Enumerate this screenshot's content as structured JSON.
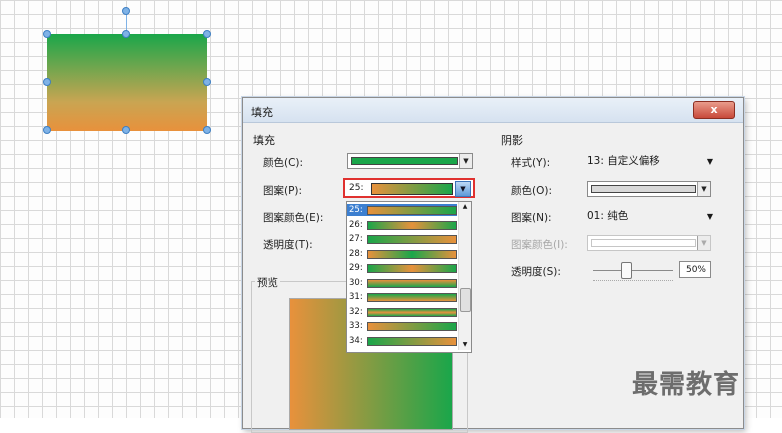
{
  "dialog": {
    "title": "填充",
    "close_label": "x",
    "fill": {
      "section": "填充",
      "color_label": "颜色(C):",
      "color_value": "#1aa64a",
      "pattern_label": "图案(P):",
      "pattern_value": "25:",
      "pattern_color_label": "图案颜色(E):",
      "transparency_label": "透明度(T):",
      "pattern_list": [
        {
          "n": "25:",
          "selected": true,
          "swatch": "linear-gradient(to right,#e8913c,#1aa64a)"
        },
        {
          "n": "26:",
          "selected": false,
          "swatch": "radial-gradient(circle,#e8913c,#1aa64a)"
        },
        {
          "n": "27:",
          "selected": false,
          "swatch": "linear-gradient(to right,#1aa64a,#e8913c)"
        },
        {
          "n": "28:",
          "selected": false,
          "swatch": "linear-gradient(to right,#e8913c,#1aa64a,#e8913c)"
        },
        {
          "n": "29:",
          "selected": false,
          "swatch": "linear-gradient(to right,#1aa64a,#e8913c,#1aa64a)"
        },
        {
          "n": "30:",
          "selected": false,
          "swatch": "linear-gradient(to bottom,#e8913c,#1aa64a)"
        },
        {
          "n": "31:",
          "selected": false,
          "swatch": "linear-gradient(to bottom,#1aa64a,#e8913c)"
        },
        {
          "n": "32:",
          "selected": false,
          "swatch": "linear-gradient(to bottom,#1aa64a,#e8913c,#1aa64a)"
        },
        {
          "n": "33:",
          "selected": false,
          "swatch": "linear-gradient(to right,#e8913c,#1aa64a)"
        },
        {
          "n": "34:",
          "selected": false,
          "swatch": "linear-gradient(to right,#1aa64a,#e8913c)"
        }
      ]
    },
    "preview": {
      "label": "预览"
    },
    "shadow": {
      "section": "阴影",
      "style_label": "样式(Y):",
      "style_value": "13: 自定义偏移",
      "color_label": "颜色(O):",
      "pattern_label": "图案(N):",
      "pattern_value": "01: 纯色",
      "pattern_color_label": "图案颜色(I):",
      "transparency_label": "透明度(S):",
      "transparency_value": "50%"
    }
  },
  "watermark": "最需教育",
  "colors": {
    "green": "#1aa64a",
    "orange": "#e8913c",
    "selection": "#3c7fd0",
    "highlight": "#e0312f"
  }
}
